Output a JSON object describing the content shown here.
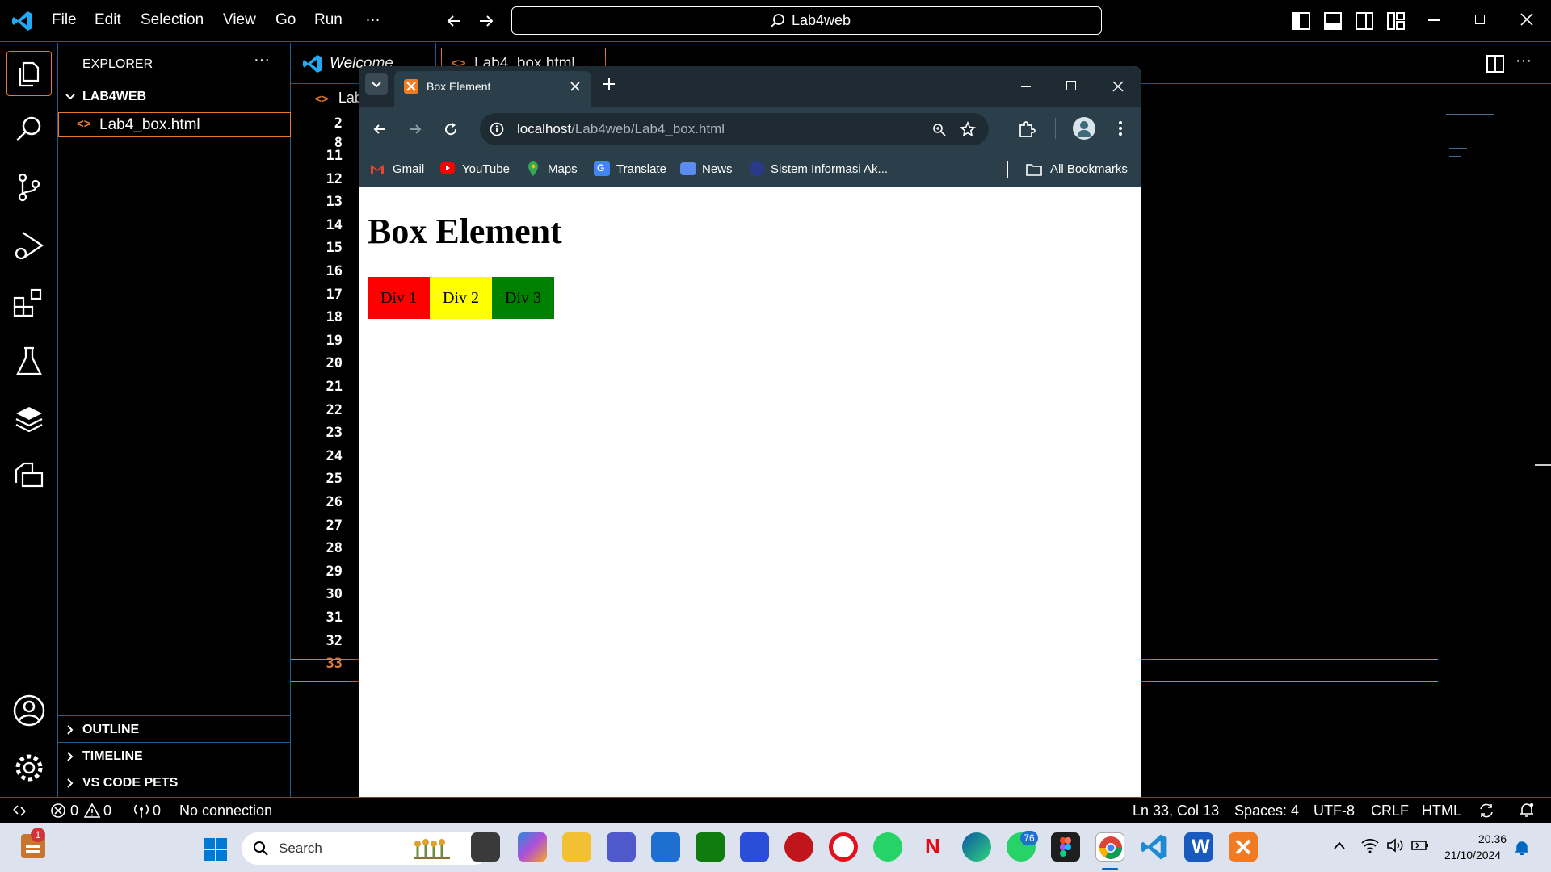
{
  "vscode": {
    "menu": [
      "File",
      "Edit",
      "Selection",
      "View",
      "Go",
      "Run",
      "…"
    ],
    "search_text": "Lab4web",
    "explorer_title": "EXPLORER",
    "folder": "LAB4WEB",
    "file": "Lab4_box.html",
    "sections": [
      "OUTLINE",
      "TIMELINE",
      "VS CODE PETS"
    ],
    "tabs": [
      "Welcome",
      "Lab4_box.html"
    ],
    "breadcrumb": "Lab",
    "line_numbers": [
      "2",
      "8",
      "11",
      "12",
      "13",
      "14",
      "15",
      "16",
      "17",
      "18",
      "19",
      "20",
      "21",
      "22",
      "23",
      "24",
      "25",
      "26",
      "27",
      "28",
      "29",
      "30",
      "31",
      "32",
      "33"
    ],
    "current_line": "33"
  },
  "status": {
    "errors": "0",
    "warnings": "0",
    "ports": "0",
    "connection": "No connection",
    "position": "Ln 33, Col 13",
    "spaces": "Spaces: 4",
    "encoding": "UTF-8",
    "eol": "CRLF",
    "language": "HTML"
  },
  "chrome": {
    "tab_title": "Box Element",
    "url_host": "localhost",
    "url_path": "/Lab4web/Lab4_box.html",
    "bookmarks": [
      "Gmail",
      "YouTube",
      "Maps",
      "Translate",
      "News",
      "Sistem Informasi Ak..."
    ],
    "all_bookmarks": "All Bookmarks"
  },
  "page": {
    "heading": "Box Element",
    "boxes": [
      {
        "label": "Div 1",
        "color": "#ff0000"
      },
      {
        "label": "Div 2",
        "color": "#ffff00"
      },
      {
        "label": "Div 3",
        "color": "#008000"
      }
    ]
  },
  "taskbar": {
    "search_label": "Search",
    "time": "20.36",
    "date": "21/10/2024",
    "badge_widgets": "1",
    "badge_whatsapp": "76"
  },
  "colors": {
    "accent_orange": "#e37933",
    "border_blue": "#1f5f8f"
  }
}
